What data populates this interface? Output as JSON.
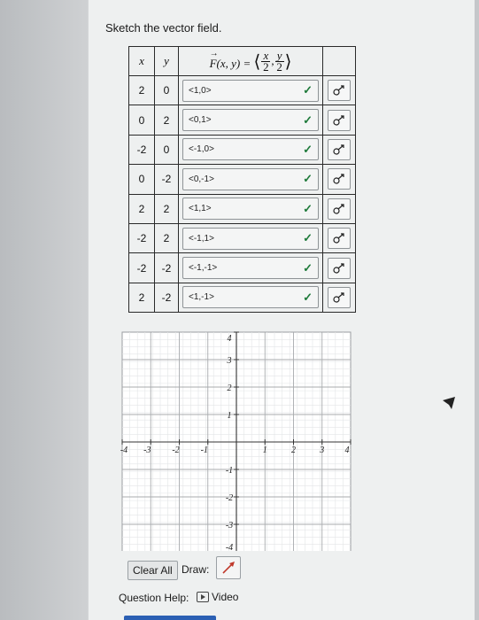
{
  "prompt": "Sketch the vector field.",
  "table": {
    "headers": {
      "x": "x",
      "y": "y",
      "f_lhs": "F(x, y) =",
      "f_rhs_x": "x",
      "f_rhs_y": "y",
      "f_rhs_den": "2"
    },
    "rows": [
      {
        "x": "2",
        "y": "0",
        "answer": "<1,0>"
      },
      {
        "x": "0",
        "y": "2",
        "answer": "<0,1>"
      },
      {
        "x": "-2",
        "y": "0",
        "answer": "<-1,0>"
      },
      {
        "x": "0",
        "y": "-2",
        "answer": "<0,-1>"
      },
      {
        "x": "2",
        "y": "2",
        "answer": "<1,1>"
      },
      {
        "x": "-2",
        "y": "2",
        "answer": "<-1,1>"
      },
      {
        "x": "-2",
        "y": "-2",
        "answer": "<-1,-1>"
      },
      {
        "x": "2",
        "y": "-2",
        "answer": "<1,-1>"
      }
    ],
    "check_icon": "check-icon",
    "sketch_icon": "sketch-icon"
  },
  "graph": {
    "x_ticks": [
      "-4",
      "-3",
      "-2",
      "-1",
      "1",
      "2",
      "3",
      "4"
    ],
    "y_ticks": [
      "4",
      "3",
      "2",
      "1",
      "-1",
      "-2",
      "-3",
      "-4"
    ],
    "xlim": [
      -4,
      4
    ],
    "ylim": [
      -4,
      4
    ]
  },
  "controls": {
    "clear_all": "Clear All",
    "draw_label": "Draw:",
    "question_help": "Question Help:",
    "video": "Video"
  },
  "colors": {
    "check": "#1e7a3a",
    "draw_tool": "#c0392b",
    "button_bar": "#2b5fb3"
  }
}
